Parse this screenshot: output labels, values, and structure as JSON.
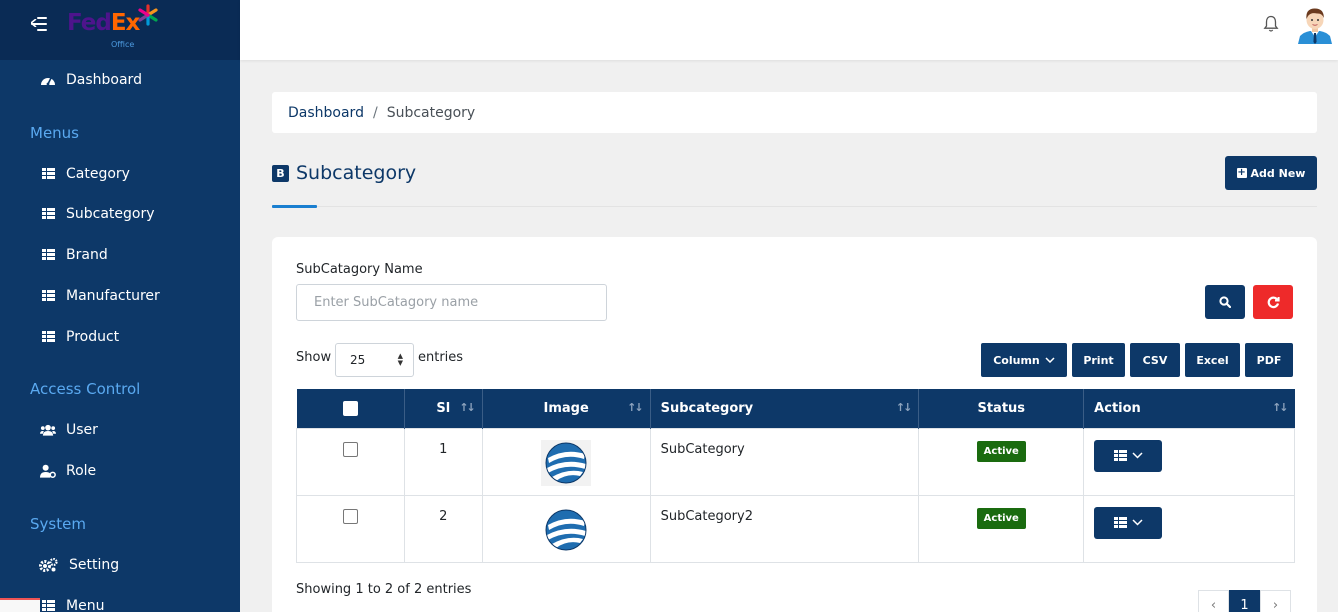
{
  "brand": {
    "logo_main": "FedEx",
    "logo_sub": "Office"
  },
  "sidebar": {
    "dashboard": "Dashboard",
    "sections": [
      "Menus",
      "Access Control",
      "System"
    ],
    "menus": [
      {
        "label": "Category",
        "icon": "table-icon"
      },
      {
        "label": "Subcategory",
        "icon": "table-icon"
      },
      {
        "label": "Brand",
        "icon": "table-icon"
      },
      {
        "label": "Manufacturer",
        "icon": "table-icon"
      },
      {
        "label": "Product",
        "icon": "table-icon"
      }
    ],
    "access": [
      {
        "label": "User",
        "icon": "users-icon"
      },
      {
        "label": "Role",
        "icon": "user-gear-icon"
      }
    ],
    "system": [
      {
        "label": "Setting",
        "icon": "gears-icon"
      },
      {
        "label": "Menu",
        "icon": "table-icon"
      }
    ]
  },
  "breadcrumb": {
    "home": "Dashboard",
    "separator": "/",
    "current": "Subcategory"
  },
  "page": {
    "icon_letter": "B",
    "title": "Subcategory",
    "add_new": "Add New"
  },
  "filter": {
    "label": "SubCatagory Name",
    "placeholder": "Enter SubCatagory name"
  },
  "table_controls": {
    "show": "Show",
    "entries": "entries",
    "page_size": "25",
    "buttons": {
      "column": "Column",
      "print": "Print",
      "csv": "CSV",
      "excel": "Excel",
      "pdf": "PDF"
    }
  },
  "table": {
    "headers": {
      "sl": "Sl",
      "image": "Image",
      "subcategory": "Subcategory",
      "status": "Status",
      "action": "Action"
    },
    "rows": [
      {
        "sl": "1",
        "name": "SubCategory",
        "status": "Active"
      },
      {
        "sl": "2",
        "name": "SubCategory2",
        "status": "Active"
      }
    ]
  },
  "footer": {
    "showing": "Showing 1 to 2 of 2 entries",
    "current_page": "1",
    "prev": "‹",
    "next": "›"
  },
  "colors": {
    "primary": "#0d3868",
    "danger": "#ee2a2a",
    "success": "#1a6b0f",
    "section": "#5aa9f0"
  }
}
